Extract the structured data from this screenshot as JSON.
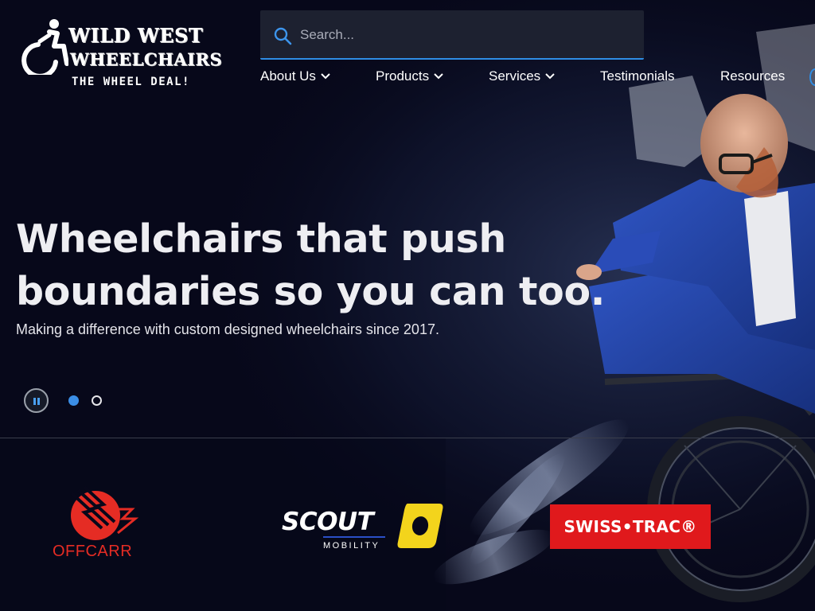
{
  "header": {
    "logo": {
      "line1": "WILD WEST",
      "line2": "WHEELCHAIRS",
      "tagline": "THE WHEEL DEAL!"
    },
    "search": {
      "placeholder": "Search...",
      "value": "",
      "icon": "search-icon"
    },
    "nav": [
      {
        "label": "About Us",
        "has_dropdown": true
      },
      {
        "label": "Products",
        "has_dropdown": true
      },
      {
        "label": "Services",
        "has_dropdown": true
      },
      {
        "label": "Testimonials",
        "has_dropdown": false
      },
      {
        "label": "Resources",
        "has_dropdown": false
      }
    ]
  },
  "hero": {
    "title": "Wheelchairs that push boundaries so you can too.",
    "subtitle": "Making a difference with custom designed wheelchairs since 2017.",
    "carousel": {
      "slide_count": 2,
      "active_index": 0,
      "pause_icon": "pause-icon"
    }
  },
  "brands": [
    {
      "name": "OFFCARR",
      "color": "#e52c24"
    },
    {
      "name": "SCOUT",
      "sub": "MOBILITY",
      "color": "#f3d41c"
    },
    {
      "name": "SWISS•TRAC®",
      "color": "#e0191c"
    }
  ],
  "colors": {
    "background": "#07081a",
    "accent": "#3b8ee6",
    "search_bg": "#1d2130"
  }
}
